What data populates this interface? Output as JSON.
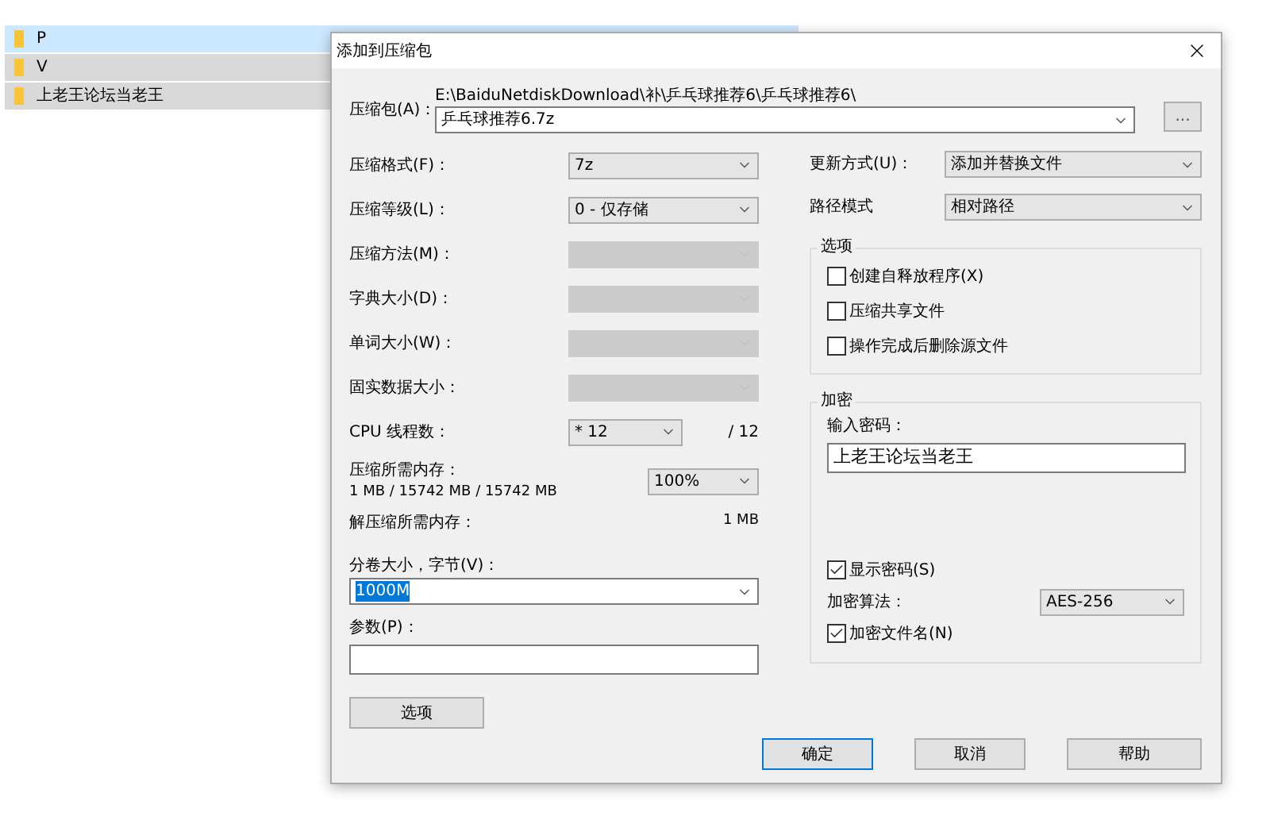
{
  "file_list": {
    "rows": [
      {
        "name": "P",
        "selected": true
      },
      {
        "name": "V",
        "selected": false
      },
      {
        "name": "上老王论坛当老王",
        "selected": false
      }
    ]
  },
  "dialog": {
    "title": "添加到压缩包",
    "archive": {
      "label": "压缩包(A)：",
      "path": "E:\\BaiduNetdiskDownload\\补\\乒乓球推荐6\\乒乓球推荐6\\",
      "value": "乒乓球推荐6.7z",
      "browse_button": "..."
    },
    "left_fields": [
      {
        "label": "压缩格式(F)：",
        "value": "7z",
        "disabled": false
      },
      {
        "label": "压缩等级(L)：",
        "value": "0 - 仅存储",
        "disabled": false
      },
      {
        "label": "压缩方法(M)：",
        "disabled": true
      },
      {
        "label": "字典大小(D)：",
        "disabled": true
      },
      {
        "label": "单词大小(W)：",
        "disabled": true
      },
      {
        "label": "固实数据大小：",
        "disabled": true
      }
    ],
    "threads": {
      "label": "CPU 线程数：",
      "value": "* 12",
      "max": "/ 12"
    },
    "memory": {
      "label": "压缩所需内存：",
      "detail": "1 MB / 15742 MB / 15742 MB",
      "value": "100%"
    },
    "decompress_memory": {
      "label": "解压缩所需内存：",
      "value": "1 MB"
    },
    "volume": {
      "label": "分卷大小，字节(V)：",
      "value": "1000M",
      "selected": true
    },
    "parameters": {
      "label": "参数(P)："
    },
    "options_button": "选项",
    "right_fields": [
      {
        "label": "更新方式(U)：",
        "value": "添加并替换文件"
      },
      {
        "label": "路径模式",
        "value": "相对路径"
      }
    ],
    "options_group": {
      "title": "选项",
      "checkboxes": [
        {
          "label": "创建自释放程序(X)",
          "checked": false
        },
        {
          "label": "压缩共享文件",
          "checked": false
        },
        {
          "label": "操作完成后删除源文件",
          "checked": false
        }
      ]
    },
    "encryption": {
      "title": "加密",
      "password_label": "输入密码：",
      "password": "上老王论坛当老王",
      "show_password": {
        "label": "显示密码(S)",
        "checked": true
      },
      "method_label": "加密算法：",
      "method": "AES-256",
      "encrypt_names": {
        "label": "加密文件名(N)",
        "checked": true
      }
    },
    "buttons": [
      {
        "label": "确定",
        "default": true
      },
      {
        "label": "取消",
        "default": false
      },
      {
        "label": "帮助",
        "default": false
      }
    ]
  }
}
